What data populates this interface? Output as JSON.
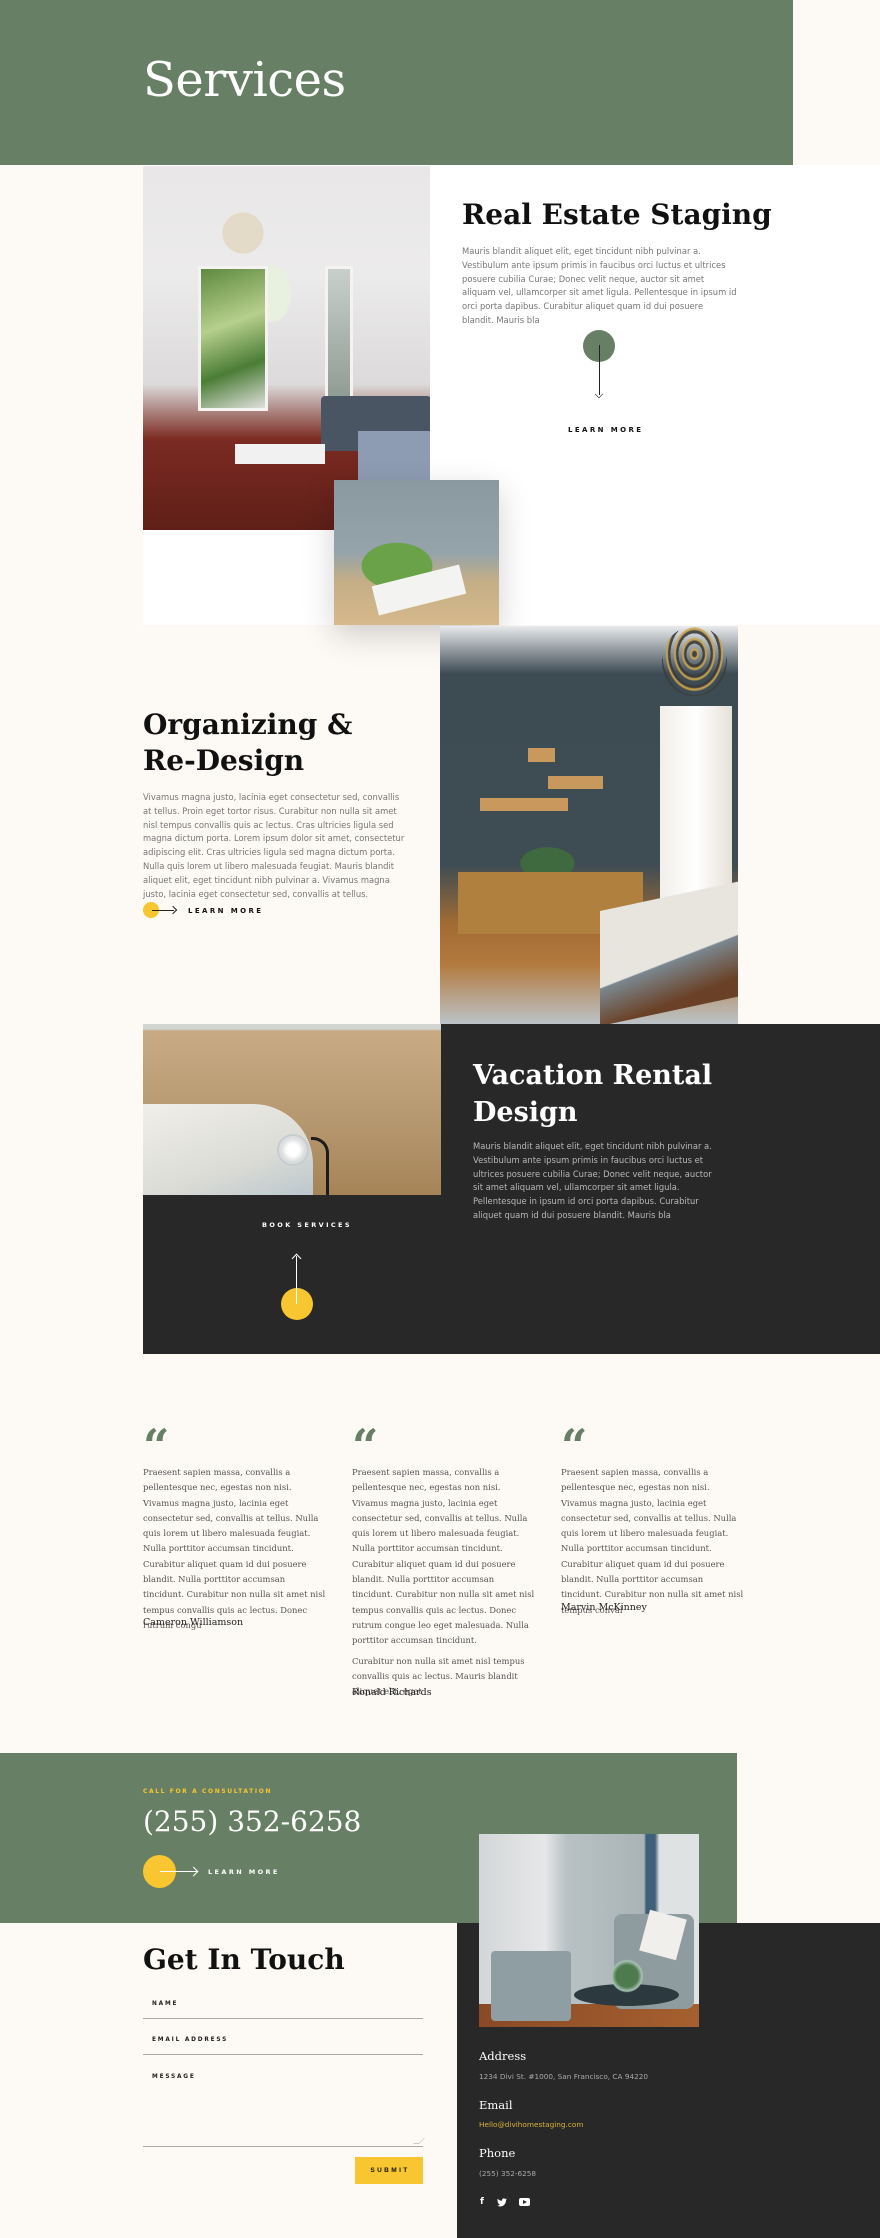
{
  "hero": {
    "title": "Services"
  },
  "colors": {
    "primary_green": "#677f64",
    "accent_yellow": "#f8c630",
    "dark": "#282828",
    "cream": "#fdf9f5"
  },
  "services": [
    {
      "title": "Real Estate Staging",
      "body": "Mauris blandit aliquet elit, eget tincidunt nibh pulvinar a. Vestibulum ante ipsum primis in faucibus orci luctus et ultrices posuere cubilia Curae; Donec velit neque, auctor sit amet aliquam vel, ullamcorper sit amet ligula. Pellentesque in ipsum id orci porta dapibus. Curabitur aliquet quam id dui posuere blandit. Mauris bla",
      "cta": "LEARN MORE",
      "icon": "arrow-down-icon"
    },
    {
      "title": "Organizing & Re-Design",
      "body": "Vivamus magna justo, lacinia eget consectetur sed, convallis at tellus. Proin eget tortor risus. Curabitur non nulla sit amet nisl tempus convallis quis ac lectus. Cras ultricies ligula sed magna dictum porta. Lorem ipsum dolor sit amet, consectetur adipiscing elit. Cras ultricies ligula sed magna dictum porta. Nulla quis lorem ut libero malesuada feugiat. Mauris blandit aliquet elit, eget tincidunt nibh pulvinar a. Vivamus magna justo, lacinia eget consectetur sed, convallis at tellus.",
      "cta": "LEARN MORE",
      "icon": "arrow-right-icon"
    },
    {
      "title": "Vacation Rental Design",
      "body": "Mauris blandit aliquet elit, eget tincidunt nibh pulvinar a. Vestibulum ante ipsum primis in faucibus orci luctus et ultrices posuere cubilia Curae; Donec velit neque, auctor sit amet aliquam vel, ullamcorper sit amet ligula. Pellentesque in ipsum id orci porta dapibus. Curabitur aliquet quam id dui posuere blandit. Mauris bla",
      "cta": "BOOK SERVICES",
      "icon": "arrow-up-icon"
    }
  ],
  "testimonials": [
    {
      "quote_icon": "“",
      "paragraphs": [
        "Praesent sapien massa, convallis a pellentesque nec, egestas non nisi. Vivamus magna justo, lacinia eget consectetur sed, convallis at tellus. Nulla quis lorem ut libero malesuada feugiat. Nulla porttitor accumsan tincidunt. Curabitur aliquet quam id dui posuere blandit. Nulla porttitor accumsan tincidunt. Curabitur non nulla sit amet nisl tempus convallis quis ac lectus. Donec rutrum congu"
      ],
      "name": "Cameron Williamson"
    },
    {
      "quote_icon": "“",
      "paragraphs": [
        "Praesent sapien massa, convallis a pellentesque nec, egestas non nisi. Vivamus magna justo, lacinia eget consectetur sed, convallis at tellus. Nulla quis lorem ut libero malesuada feugiat. Nulla porttitor accumsan tincidunt. Curabitur aliquet quam id dui posuere blandit. Nulla porttitor accumsan tincidunt. Curabitur non nulla sit amet nisl tempus convallis quis ac lectus. Donec rutrum congue leo eget malesuada. Nulla porttitor accumsan tincidunt.",
        "Curabitur non nulla sit amet nisl tempus convallis quis ac lectus. Mauris blandit aliquet elit, eget"
      ],
      "name": "Ronald Richards"
    },
    {
      "quote_icon": "“",
      "paragraphs": [
        "Praesent sapien massa, convallis a pellentesque nec, egestas non nisi. Vivamus magna justo, lacinia eget consectetur sed, convallis at tellus. Nulla quis lorem ut libero malesuada feugiat. Nulla porttitor accumsan tincidunt. Curabitur aliquet quam id dui posuere blandit. Nulla porttitor accumsan tincidunt. Curabitur non nulla sit amet nisl tempus conval"
      ],
      "name": "Marvin McKinney"
    }
  ],
  "cta": {
    "eyebrow": "CALL FOR A CONSULTATION",
    "phone": "(255) 352-6258",
    "button": "LEARN MORE"
  },
  "contact_form": {
    "title": "Get In Touch",
    "fields": {
      "name": {
        "placeholder": "NAME",
        "value": ""
      },
      "email": {
        "placeholder": "EMAIL ADDRESS",
        "value": ""
      },
      "message": {
        "placeholder": "MESSAGE",
        "value": ""
      }
    },
    "submit": "SUBMIT"
  },
  "contact_info": {
    "address_label": "Address",
    "address": "1234 Divi St. #1000, San Francisco, CA 94220",
    "email_label": "Email",
    "email": "Hello@divihomestaging.com",
    "phone_label": "Phone",
    "phone": "(255) 352-6258",
    "social": [
      {
        "name": "facebook-icon",
        "glyph": "f"
      },
      {
        "name": "twitter-icon",
        "glyph": "🐦"
      },
      {
        "name": "youtube-icon",
        "glyph": ""
      }
    ]
  }
}
